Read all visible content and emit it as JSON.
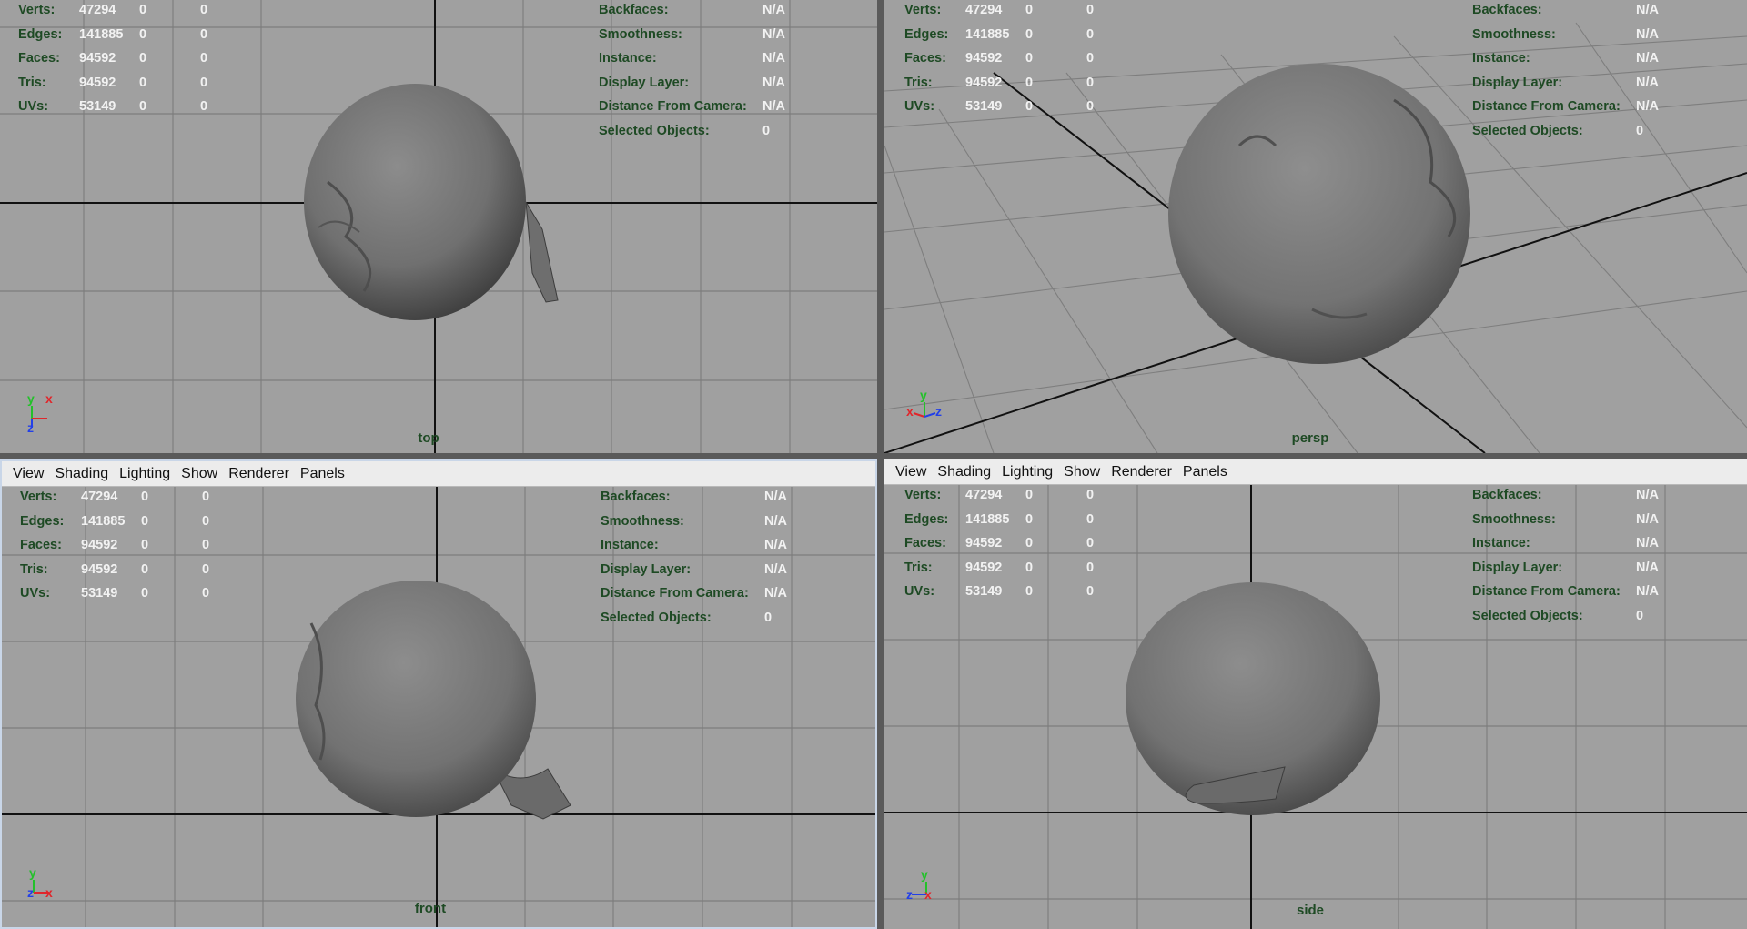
{
  "menu": [
    "View",
    "Shading",
    "Lighting",
    "Show",
    "Renderer",
    "Panels"
  ],
  "stats": {
    "labels": [
      "Verts:",
      "Edges:",
      "Faces:",
      "Tris:",
      "UVs:"
    ],
    "rows": [
      [
        "47294",
        "0",
        "0"
      ],
      [
        "141885",
        "0",
        "0"
      ],
      [
        "94592",
        "0",
        "0"
      ],
      [
        "94592",
        "0",
        "0"
      ],
      [
        "53149",
        "0",
        "0"
      ]
    ]
  },
  "info": [
    {
      "label": "Backfaces:",
      "value": "N/A"
    },
    {
      "label": "Smoothness:",
      "value": "N/A"
    },
    {
      "label": "Instance:",
      "value": "N/A"
    },
    {
      "label": "Display Layer:",
      "value": "N/A"
    },
    {
      "label": "Distance From Camera:",
      "value": "N/A"
    },
    {
      "label": "Selected Objects:",
      "value": "0"
    }
  ],
  "viewports": {
    "top": {
      "camera": "top",
      "axes": [
        "y",
        "x",
        "z"
      ]
    },
    "persp": {
      "camera": "persp",
      "axes": [
        "x",
        "y",
        "z"
      ]
    },
    "front": {
      "camera": "front",
      "axes": [
        "y",
        "z",
        "x"
      ]
    },
    "side": {
      "camera": "side",
      "axes": [
        "y",
        "z",
        "x"
      ]
    }
  },
  "colors": {
    "viewport_bg": "#a0a0a0",
    "grid": "#7e7e7e",
    "axis_line": "#111111",
    "hud_label": "#1e4a24",
    "hud_value": "#f2f2f2",
    "axis_x": "#e0262b",
    "axis_y": "#23c12a",
    "axis_z": "#2340e8"
  }
}
